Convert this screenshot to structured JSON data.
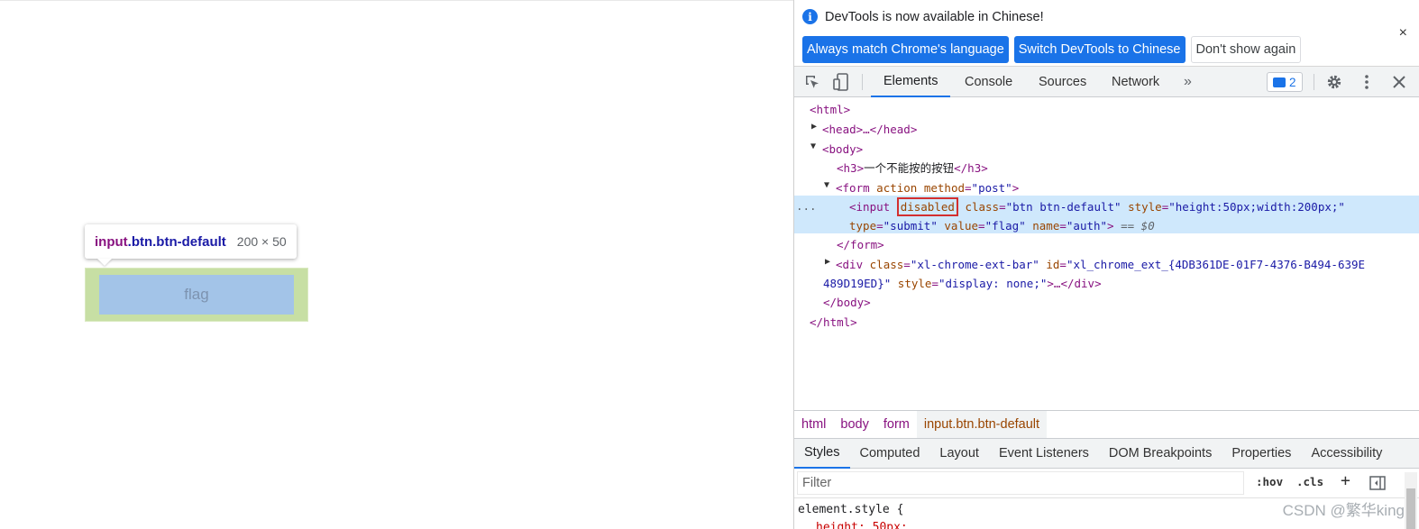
{
  "page": {
    "tooltip": {
      "tag": "input",
      "classes": ".btn.btn-default",
      "size": "200 × 50"
    },
    "button_label": "flag"
  },
  "infobar": {
    "message": "DevTools is now available in Chinese!",
    "buttons": [
      "Always match Chrome's language",
      "Switch DevTools to Chinese",
      "Don't show again"
    ],
    "close_glyph": "×"
  },
  "toolbar": {
    "tabs": [
      "Elements",
      "Console",
      "Sources",
      "Network"
    ],
    "active_tab": "Elements",
    "more_glyph": "»",
    "issues_count": "2"
  },
  "dom": {
    "lines": {
      "html_open": "<html>",
      "head": "<head>…</head>",
      "body_open": "<body>",
      "h3_open": "<h3>",
      "h3_text": "一个不能按的按钮",
      "h3_close": "</h3>",
      "form_open_tag": "<form",
      "form_attr1": "action",
      "form_attr2": "method",
      "form_attr2_val": "\"post\"",
      "form_end": ">",
      "input_tag": "<input",
      "input_disabled": "disabled",
      "input_class_attr": "class",
      "input_class_val": "\"btn btn-default\"",
      "input_style_attr": "style",
      "input_style_val": "\"height:50px;width:200px;\"",
      "input_type_attr": "type",
      "input_type_val": "\"submit\"",
      "input_value_attr": "value",
      "input_value_val": "\"flag\"",
      "input_name_attr": "name",
      "input_name_val": "\"auth\"",
      "input_end": ">",
      "input_suffix": "== $0",
      "form_close": "</form>",
      "div_tag": "<div",
      "div_class_attr": "class",
      "div_class_val": "\"xl-chrome-ext-bar\"",
      "div_id_attr": "id",
      "div_id_val_part1": "\"xl_chrome_ext_{4DB361DE-01F7-4376-B494-639E",
      "div_id_val_part2": "489D19ED}\"",
      "div_style_attr": "style",
      "div_style_val": "\"display: none;\"",
      "div_end": ">…</div>",
      "body_close": "</body>",
      "html_close": "</html>",
      "dots": "..."
    }
  },
  "breadcrumbs": [
    "html",
    "body",
    "form",
    "input.btn.btn-default"
  ],
  "subtabs": [
    "Styles",
    "Computed",
    "Layout",
    "Event Listeners",
    "DOM Breakpoints",
    "Properties",
    "Accessibility"
  ],
  "active_subtab": "Styles",
  "filter": {
    "placeholder": "Filter",
    "hov": ":hov",
    "cls": ".cls",
    "plus": "+"
  },
  "styles": {
    "selector": "element.style {",
    "partial_prop": "height: 50px;"
  },
  "watermark": "CSDN @繁华king"
}
